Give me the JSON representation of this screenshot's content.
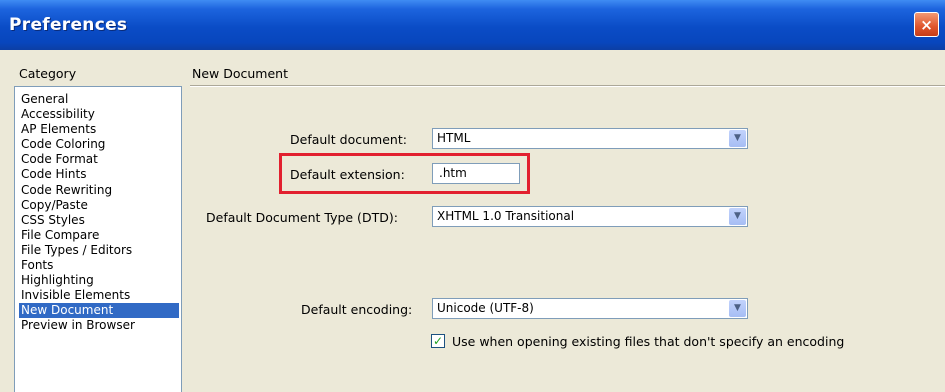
{
  "window": {
    "title": "Preferences",
    "close_icon": "×"
  },
  "category": {
    "label": "Category",
    "items": [
      "General",
      "Accessibility",
      "AP Elements",
      "Code Coloring",
      "Code Format",
      "Code Hints",
      "Code Rewriting",
      "Copy/Paste",
      "CSS Styles",
      "File Compare",
      "File Types / Editors",
      "Fonts",
      "Highlighting",
      "Invisible Elements",
      "New Document",
      "Preview in Browser"
    ],
    "selected": "New Document"
  },
  "panel": {
    "title": "New Document",
    "default_document": {
      "label": "Default document:",
      "value": "HTML"
    },
    "default_extension": {
      "label": "Default extension:",
      "value": ".htm"
    },
    "default_doctype": {
      "label": "Default Document Type (DTD):",
      "value": "XHTML 1.0 Transitional"
    },
    "default_encoding": {
      "label": "Default encoding:",
      "value": "Unicode (UTF-8)"
    },
    "use_when_opening": {
      "label": "Use when opening existing files that don't specify an encoding",
      "checked": true
    }
  },
  "colors": {
    "highlight_box": "#e2202f",
    "selection": "#316ac5",
    "titlebar": "#0a4cc6"
  }
}
